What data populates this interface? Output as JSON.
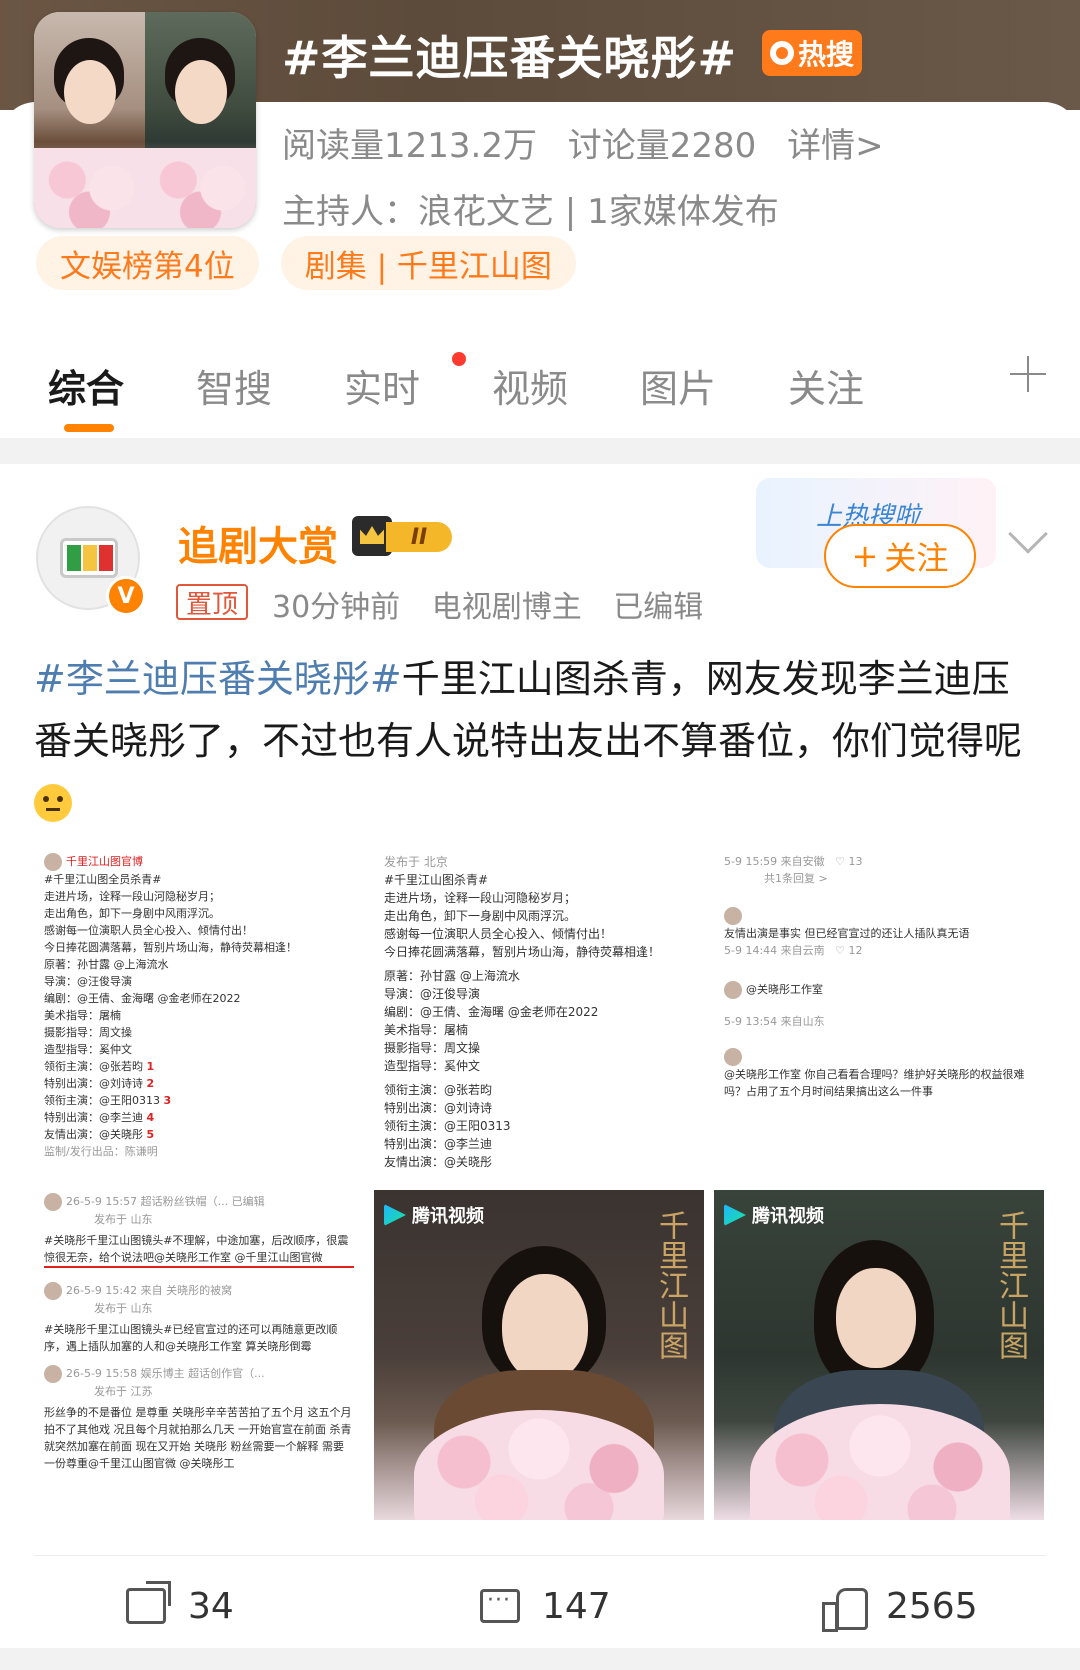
{
  "topic": {
    "title": "#李兰迪压番关晓彤#",
    "hot_badge": "热搜",
    "reads": "阅读量1213.2万",
    "discussions": "讨论量2280",
    "details": "详情>",
    "host": "主持人：浪花文艺 | 1家媒体发布",
    "tags": [
      "文娱榜第4位",
      "剧集 | 千里江山图"
    ],
    "colors": {
      "accent": "#ff8200",
      "hot": "#ff7a1a"
    }
  },
  "tabs": [
    "综合",
    "智搜",
    "实时",
    "视频",
    "图片",
    "关注"
  ],
  "post": {
    "username": "追剧大赏",
    "level_badge": "II",
    "pinned": "置顶",
    "time": "30分钟前",
    "role": "电视剧博主",
    "edited": "已编辑",
    "follow_label": "关注",
    "follow_deco": "上热搜啦",
    "hashtag": "#李兰迪压番关晓彤#",
    "body": "千里江山图杀青，网友发现李兰迪压番关晓彤了，不过也有人说特出友出不算番位，你们觉得呢",
    "images": {
      "shot1": {
        "author": "千里江山图官博",
        "lines": [
          "#千里江山图全员杀青#",
          "走进片场，诠释一段山河隐秘岁月；",
          "走出角色，卸下一身剧中风雨浮沉。",
          "感谢每一位演职人员全心投入、倾情付出！",
          "今日捧花圆满落幕，暂别片场山海，静待荧幕相逢！",
          "原著：孙甘露 @上海流水",
          "导演：@汪俊导演",
          "编剧：@王倩、金海曙 @金老师在2022",
          "美术指导：屠楠",
          "摄影指导：周文操",
          "造型指导：奚仲文",
          "领衔主演：@张若昀",
          "特别出演：@刘诗诗",
          "领衔主演：@王阳0313",
          "特别出演：@李兰迪",
          "友情出演：@关晓彤",
          "监制/发行出品：陈谦明"
        ],
        "marks": [
          "1",
          "2",
          "3",
          "4",
          "5"
        ]
      },
      "shot2": {
        "header": "发布于 北京",
        "lines": [
          "#千里江山图杀青#",
          "走进片场，诠释一段山河隐秘岁月；",
          "走出角色，卸下一身剧中风雨浮沉。",
          "感谢每一位演职人员全心投入、倾情付出！",
          "今日捧花圆满落幕，暂别片场山海，静待荧幕相逢！",
          "原著：孙甘露 @上海流水",
          "导演：@汪俊导演",
          "编剧：@王倩、金海曙 @金老师在2022",
          "美术指导：屠楠",
          "摄影指导：周文操",
          "造型指导：奚仲文",
          "领衔主演：@张若昀",
          "特别出演：@刘诗诗",
          "领衔主演：@王阳0313",
          "特别出演：@李兰迪",
          "友情出演：@关晓彤"
        ]
      },
      "shot3": {
        "comments": [
          {
            "meta": "5-9 15:59 来自安徽",
            "replies": "共1条回复 >",
            "likes": "13"
          },
          {
            "text": "友情出演是事实 但已经官宣过的还让人插队真无语",
            "meta": "5-9 14:44 来自云南",
            "likes": "12"
          },
          {
            "text": "@关晓彤工作室",
            "meta": "5-9 13:54 来自山东"
          },
          {
            "text": "@关晓彤工作室 你自己看看合理吗？维护好关晓彤的权益很难吗？占用了五个月时间结果搞出这么一件事"
          }
        ]
      },
      "shot4": {
        "comments": [
          {
            "meta": "26-5-9 15:57 超话粉丝铁帽（... 已编辑",
            "from": "发布于 山东",
            "text": "#关晓彤千里江山图镜头#不理解，中途加塞，后改顺序，很震惊很无奈，给个说法吧@关晓彤工作室 @千里江山图官微"
          },
          {
            "meta": "26-5-9 15:42 来自 关晓彤的被窝",
            "from": "发布于 山东",
            "text": "#关晓彤千里江山图镜头#已经官宣过的还可以再随意更改顺序，遇上插队加塞的人和@关晓彤工作室 算关晓彤倒霉"
          },
          {
            "meta": "26-5-9 15:58 娱乐博主 超话创作官（...",
            "from": "发布于 江苏",
            "text": "形丝争的不是番位 是尊重 关晓彤辛辛苦苦拍了五个月 这五个月拍不了其他戏 况且每个月就拍那么几天 一开始官宣在前面 杀青就突然加塞在前面 现在又开始 关晓彤 粉丝需要一个解释 需要一份尊重@千里江山图官微 @关晓彤工"
          }
        ]
      },
      "photo_brand": "腾讯视频",
      "photo_title": "千里江山图"
    },
    "actions": {
      "shares": "34",
      "comments": "147",
      "likes": "2565"
    }
  }
}
